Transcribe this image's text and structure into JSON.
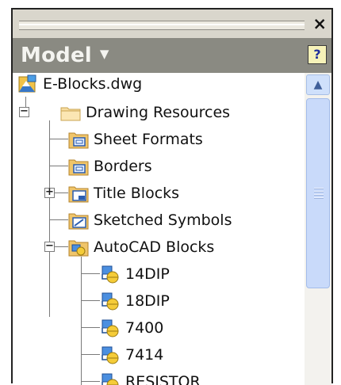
{
  "window": {
    "close_label": "×",
    "title": "Model",
    "title_arrow": "▼",
    "help_label": "?"
  },
  "tree": {
    "root": {
      "label": "E-Blocks.dwg",
      "icon": "dwg-file-icon"
    },
    "nodes": [
      {
        "label": "Drawing Resources",
        "icon": "folder-icon",
        "expander": "−"
      },
      {
        "label": "Sheet Formats",
        "icon": "sheet-format-icon"
      },
      {
        "label": "Borders",
        "icon": "border-icon",
        "expander": "+"
      },
      {
        "label": "Title Blocks",
        "icon": "title-block-icon"
      },
      {
        "label": "Sketched Symbols",
        "icon": "sketched-symbol-icon"
      },
      {
        "label": "AutoCAD Blocks",
        "icon": "autocad-block-folder-icon",
        "expander": "−"
      },
      {
        "label": "14DIP",
        "icon": "autocad-block-icon"
      },
      {
        "label": "18DIP",
        "icon": "autocad-block-icon"
      },
      {
        "label": "7400",
        "icon": "autocad-block-icon"
      },
      {
        "label": "7414",
        "icon": "autocad-block-icon"
      },
      {
        "label": "RESISTOR",
        "icon": "autocad-block-icon"
      }
    ]
  },
  "scrollbar": {
    "up_arrow": "▲"
  },
  "colors": {
    "title_bar": "#8a8a82",
    "panel": "#d9d6cc",
    "scroll_thumb": "#c9dafa"
  }
}
